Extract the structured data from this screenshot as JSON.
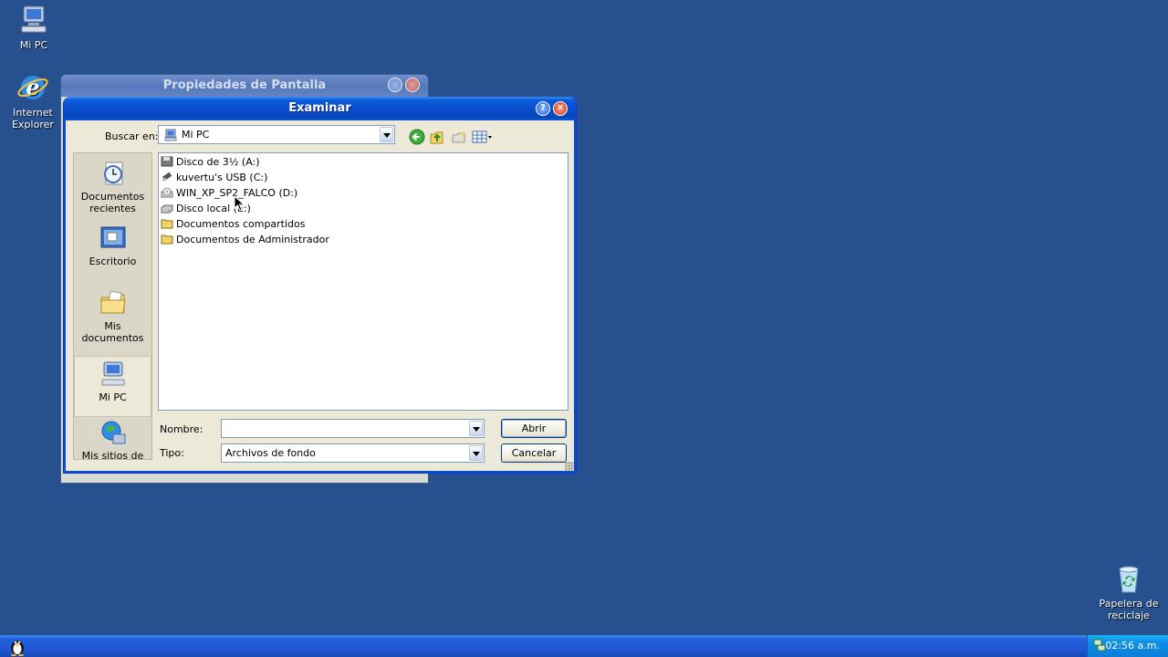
{
  "desktop": {
    "icons": [
      {
        "label": "Mi PC"
      },
      {
        "label": "Internet Explorer"
      },
      {
        "label": "Papelera de reciclaje"
      }
    ]
  },
  "background_window": {
    "title": "Propiedades de Pantalla"
  },
  "dialog": {
    "title": "Examinar",
    "look_in_label": "Buscar en:",
    "look_in_value": "Mi PC",
    "places": [
      {
        "label": "Documentos recientes"
      },
      {
        "label": "Escritorio"
      },
      {
        "label": "Mis documentos"
      },
      {
        "label": "Mi PC"
      },
      {
        "label": "Mis sitios de red"
      }
    ],
    "files": [
      {
        "name": "Disco de 3½ (A:)",
        "icon": "floppy-icon"
      },
      {
        "name": "kuvertu's USB (C:)",
        "icon": "usb-drive-icon"
      },
      {
        "name": "WIN_XP_SP2_FALCO (D:)",
        "icon": "cd-drive-icon"
      },
      {
        "name": "Disco local (E:)",
        "icon": "hard-drive-icon"
      },
      {
        "name": "Documentos compartidos",
        "icon": "folder-icon"
      },
      {
        "name": "Documentos de Administrador",
        "icon": "folder-icon"
      }
    ],
    "filename_label": "Nombre:",
    "filename_value": "",
    "filetype_label": "Tipo:",
    "filetype_value": "Archivos de fondo",
    "open_button": "Abrir",
    "cancel_button": "Cancelar"
  },
  "taskbar": {
    "clock": "02:56 a.m."
  }
}
